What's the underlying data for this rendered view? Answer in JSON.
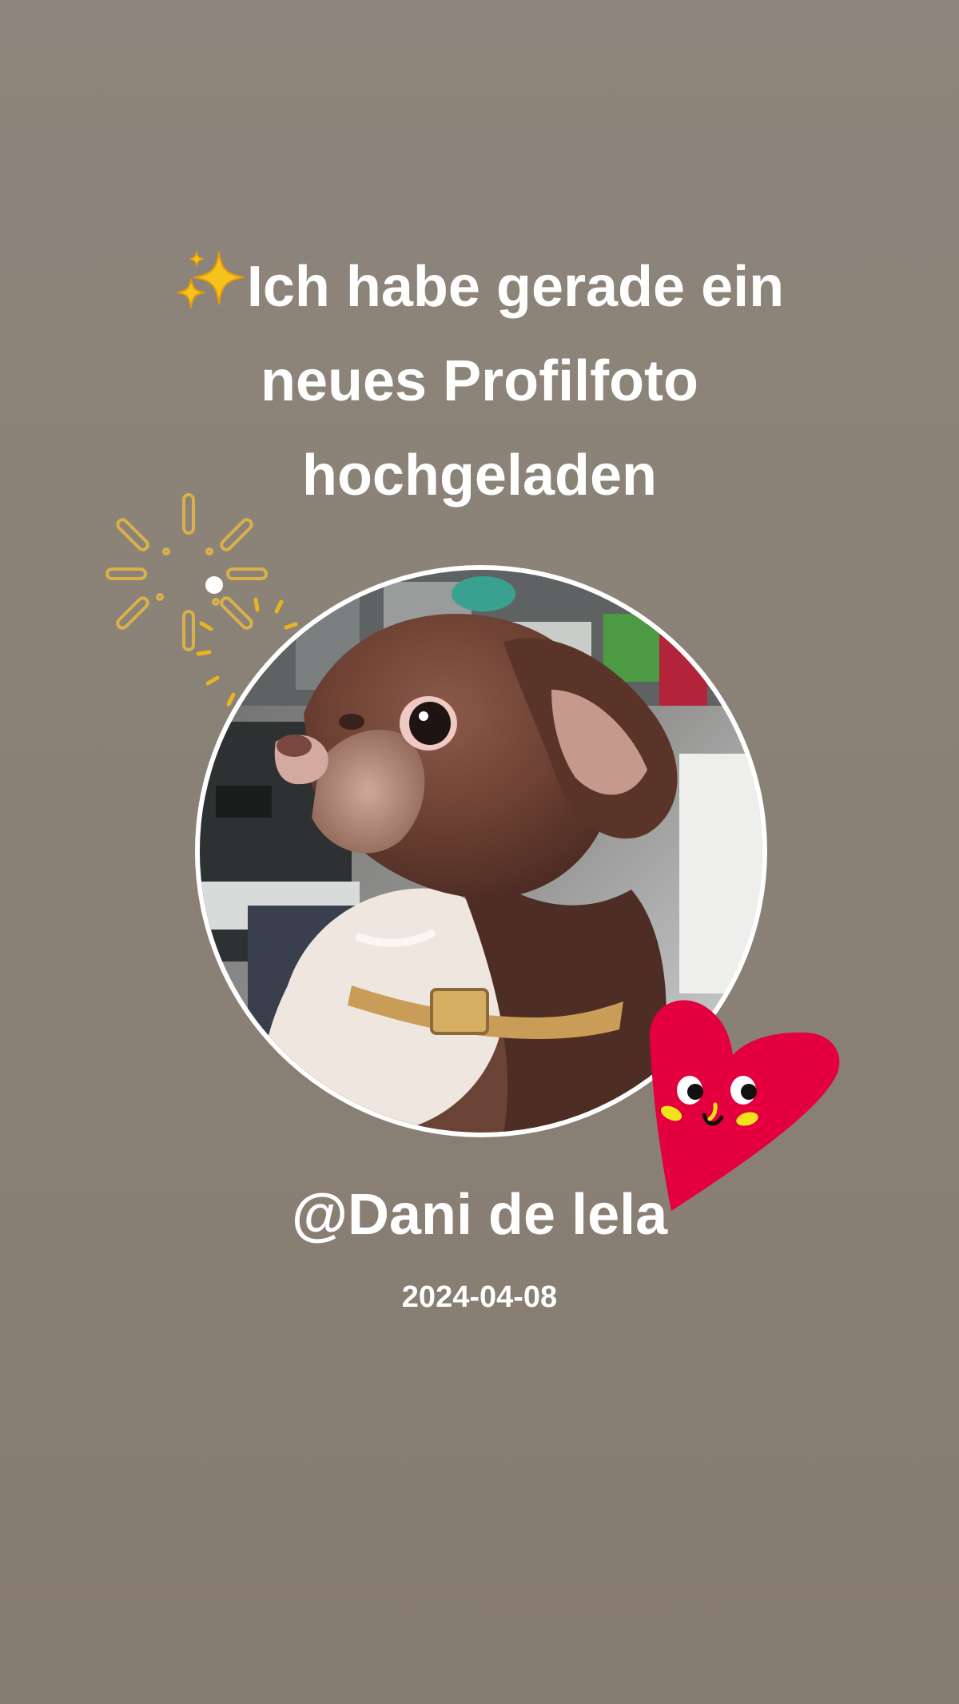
{
  "post": {
    "headline_lines": [
      "Ich habe gerade ein",
      "neues Profilfoto",
      "hochgeladen"
    ],
    "username": "@Dani de lela",
    "date": "2024-04-08"
  },
  "decorations": {
    "sparkles_icon": "sparkles-emoji",
    "burst_icon": "firework-burst",
    "heart_icon": "smiling-heart-sticker"
  },
  "colors": {
    "background": "#8a8076",
    "text": "#ffffff",
    "heart": "#e4003f",
    "burst": "#d9b04a"
  }
}
